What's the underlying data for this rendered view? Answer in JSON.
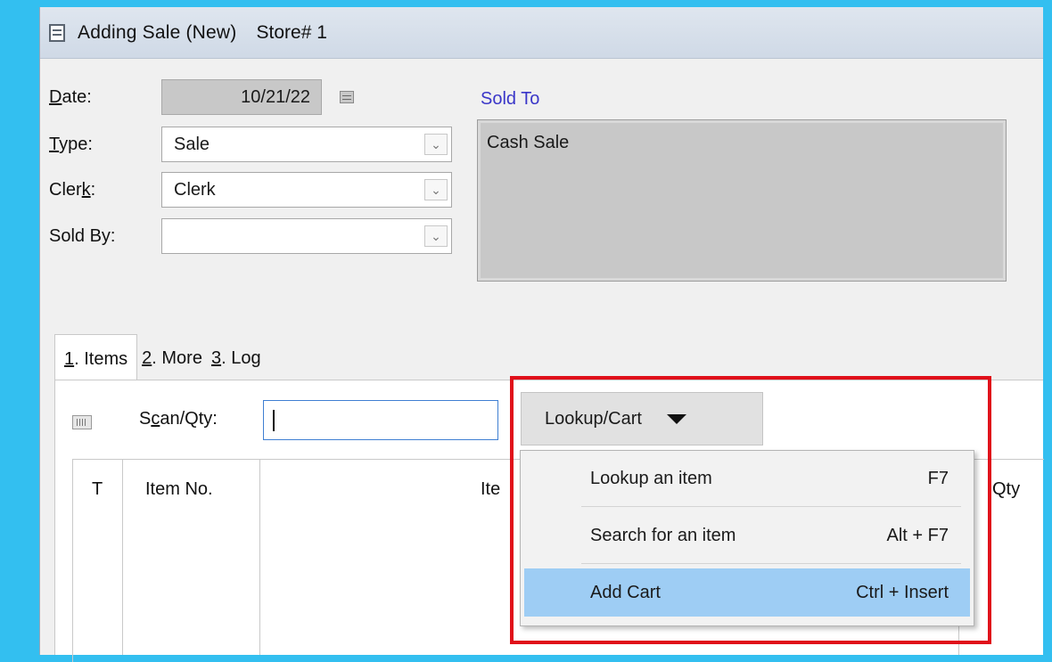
{
  "window": {
    "title": "Adding Sale  (New)",
    "store": "Store# 1",
    "icon": "document-icon"
  },
  "form": {
    "date": {
      "label": "Date:",
      "value": "10/21/22",
      "icon": "calendar-icon"
    },
    "type": {
      "label": "Type:",
      "value": "Sale"
    },
    "clerk": {
      "label": "Clerk:",
      "value": "Clerk"
    },
    "sold_by": {
      "label": "Sold By:",
      "value": ""
    }
  },
  "sold_to": {
    "label": "Sold To",
    "value": "Cash Sale"
  },
  "tabs": [
    {
      "num": "1",
      "label": ". Items"
    },
    {
      "num": "2",
      "label": ". More"
    },
    {
      "num": "3",
      "label": ". Log"
    }
  ],
  "scan": {
    "label": "Scan/Qty:",
    "value": "",
    "icon": "barcode-icon"
  },
  "lookup_button": {
    "label": "Lookup/Cart"
  },
  "grid_headers": {
    "t": "T",
    "item_no": "Item No.",
    "item": "Ite",
    "qty": "Qty"
  },
  "menu": [
    {
      "label": "Lookup an item",
      "shortcut": "F7"
    },
    {
      "label": "Search for an item",
      "shortcut": "Alt + F7"
    },
    {
      "label": "Add Cart",
      "shortcut": "Ctrl + Insert"
    }
  ],
  "colors": {
    "accent_highlight": "#9ecdf4",
    "annotation_red": "#e0101a",
    "sold_to_label": "#3a36c8"
  }
}
